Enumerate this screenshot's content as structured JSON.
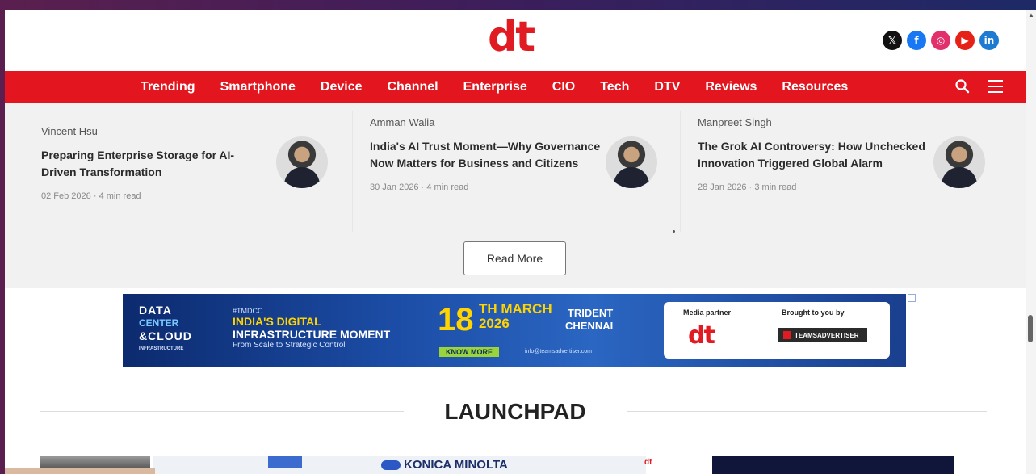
{
  "header": {
    "logo_text": "dt",
    "social": [
      {
        "icon": "x-icon",
        "glyph": "𝕏"
      },
      {
        "icon": "facebook-icon",
        "glyph": "f"
      },
      {
        "icon": "instagram-icon",
        "glyph": "◎"
      },
      {
        "icon": "youtube-icon",
        "glyph": "▶"
      },
      {
        "icon": "linkedin-icon",
        "glyph": "in"
      }
    ]
  },
  "nav": {
    "items": [
      "Trending",
      "Smartphone",
      "Device",
      "Channel",
      "Enterprise",
      "CIO",
      "Tech",
      "DTV",
      "Reviews",
      "Resources"
    ],
    "search_icon": "search-icon",
    "menu_icon": "hamburger-menu-icon",
    "accent": "#e3161f"
  },
  "articles": [
    {
      "author": "Vincent Hsu",
      "title": "Preparing Enterprise Storage for AI-Driven Transformation",
      "date": "02 Feb 2026",
      "read_time": "4 min read"
    },
    {
      "author": "Amman Walia",
      "title": "India's AI Trust Moment—Why Governance Now Matters for Business and Citizens",
      "date": "30 Jan 2026",
      "read_time": "4 min read"
    },
    {
      "author": "Manpreet Singh",
      "title": "The Grok AI Controversy: How Unchecked Innovation Triggered Global Alarm",
      "date": "28 Jan 2026",
      "read_time": "3 min read"
    }
  ],
  "read_more_label": "Read More",
  "banner": {
    "brand_line1": "DATA",
    "brand_line2": "CENTER",
    "brand_line3": "&CLOUD",
    "brand_line4": "INFRASTRUCTURE",
    "tag": "#TMDCC",
    "headline1": "INDIA'S DIGITAL",
    "headline2": "INFRASTRUCTURE MOMENT",
    "subline": "From Scale to Strategic Control",
    "day": "18",
    "month": "TH MARCH",
    "year": "2026",
    "venue1": "TRIDENT",
    "venue2": "CHENNAI",
    "cta": "KNOW MORE",
    "email": "info@teamsadvertiser.com",
    "media_partner_label": "Media partner",
    "brought_by_label": "Brought to you by",
    "partner_logo": "dt",
    "sponsor_name": "TEAMSADVERTISER"
  },
  "section_title": "LAUNCHPAD",
  "launchpad_preview": {
    "brand": "KONICA MINOLTA",
    "mini_logo": "dt"
  }
}
